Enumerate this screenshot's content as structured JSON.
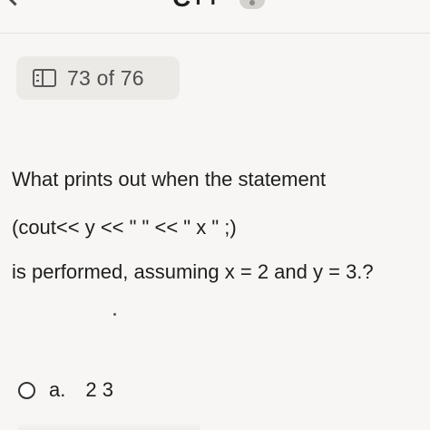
{
  "header": {
    "title": "C++",
    "back_icon": "chevron-left-icon",
    "badge_icon": "dot-icon"
  },
  "counter": {
    "icon": "book-icon",
    "text": "73 of 76"
  },
  "question": {
    "line1": "What prints out when the statement",
    "line2": "(cout<< y << \" \" << \" x \" ;)",
    "line3": "is performed, assuming x = 2 and y = 3.?"
  },
  "options": [
    {
      "letter": "a.",
      "value": "2 3"
    }
  ],
  "colors": {
    "background": "#f7f6f4",
    "pill": "#ebeae7",
    "text": "#1e1e1e"
  }
}
